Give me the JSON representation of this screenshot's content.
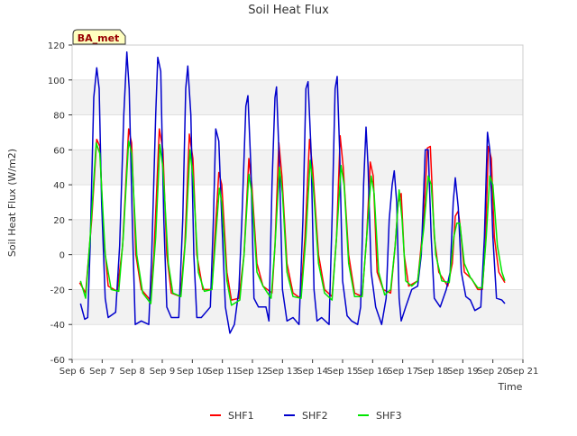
{
  "chart_data": {
    "type": "line",
    "title": "Soil Heat Flux",
    "xlabel": "Time",
    "ylabel": "Soil Heat Flux (W/m2)",
    "ylim": [
      -60,
      120
    ],
    "xlim": [
      0,
      15
    ],
    "x_ticks": [
      0,
      1,
      2,
      3,
      4,
      5,
      6,
      7,
      8,
      9,
      10,
      11,
      12,
      13,
      14,
      15
    ],
    "x_tick_labels": [
      "Sep 6",
      "Sep 7",
      "Sep 8",
      "Sep 9",
      "Sep 10",
      "Sep 11",
      "Sep 12",
      "Sep 13",
      "Sep 14",
      "Sep 15",
      "Sep 16",
      "Sep 17",
      "Sep 18",
      "Sep 19",
      "Sep 20",
      "Sep 21"
    ],
    "y_ticks": [
      -60,
      -40,
      -20,
      0,
      20,
      40,
      60,
      80,
      100,
      120
    ],
    "grid": "horizontal alternating bands",
    "legend_position": "bottom-center",
    "annotation": "BA_met",
    "series": [
      {
        "name": "SHF1",
        "color": "#ff0000",
        "points": [
          [
            0.25,
            -16
          ],
          [
            0.45,
            -22
          ],
          [
            0.65,
            20
          ],
          [
            0.82,
            66
          ],
          [
            0.92,
            62
          ],
          [
            1.05,
            10
          ],
          [
            1.2,
            -18
          ],
          [
            1.5,
            -21
          ],
          [
            1.68,
            5
          ],
          [
            1.88,
            72
          ],
          [
            1.98,
            64
          ],
          [
            2.12,
            0
          ],
          [
            2.3,
            -20
          ],
          [
            2.6,
            -26
          ],
          [
            2.72,
            0
          ],
          [
            2.9,
            72
          ],
          [
            3.02,
            60
          ],
          [
            3.15,
            0
          ],
          [
            3.3,
            -22
          ],
          [
            3.6,
            -24
          ],
          [
            3.75,
            5
          ],
          [
            3.9,
            69
          ],
          [
            4.02,
            55
          ],
          [
            4.15,
            0
          ],
          [
            4.35,
            -20
          ],
          [
            4.65,
            -20
          ],
          [
            4.75,
            10
          ],
          [
            4.88,
            47
          ],
          [
            4.98,
            40
          ],
          [
            5.15,
            -10
          ],
          [
            5.3,
            -26
          ],
          [
            5.55,
            -25
          ],
          [
            5.72,
            0
          ],
          [
            5.88,
            55
          ],
          [
            5.98,
            40
          ],
          [
            6.15,
            -5
          ],
          [
            6.35,
            -18
          ],
          [
            6.65,
            -22
          ],
          [
            6.75,
            5
          ],
          [
            6.88,
            64
          ],
          [
            6.98,
            45
          ],
          [
            7.15,
            -5
          ],
          [
            7.35,
            -22
          ],
          [
            7.6,
            -25
          ],
          [
            7.75,
            10
          ],
          [
            7.9,
            66
          ],
          [
            8.0,
            50
          ],
          [
            8.2,
            0
          ],
          [
            8.4,
            -20
          ],
          [
            8.65,
            -24
          ],
          [
            8.8,
            10
          ],
          [
            8.92,
            68
          ],
          [
            9.02,
            50
          ],
          [
            9.2,
            0
          ],
          [
            9.4,
            -22
          ],
          [
            9.65,
            -24
          ],
          [
            9.8,
            10
          ],
          [
            9.92,
            53
          ],
          [
            10.02,
            45
          ],
          [
            10.15,
            -10
          ],
          [
            10.35,
            -20
          ],
          [
            10.6,
            -22
          ],
          [
            10.75,
            5
          ],
          [
            10.85,
            30
          ],
          [
            10.95,
            35
          ],
          [
            11.05,
            0
          ],
          [
            11.2,
            -18
          ],
          [
            11.5,
            -15
          ],
          [
            11.7,
            20
          ],
          [
            11.82,
            61
          ],
          [
            11.92,
            62
          ],
          [
            12.05,
            10
          ],
          [
            12.2,
            -10
          ],
          [
            12.5,
            -18
          ],
          [
            12.65,
            -5
          ],
          [
            12.75,
            22
          ],
          [
            12.85,
            25
          ],
          [
            12.92,
            15
          ],
          [
            13.05,
            -10
          ],
          [
            13.3,
            -14
          ],
          [
            13.5,
            -20
          ],
          [
            13.65,
            -20
          ],
          [
            13.75,
            5
          ],
          [
            13.85,
            62
          ],
          [
            13.95,
            55
          ],
          [
            14.05,
            10
          ],
          [
            14.2,
            -10
          ],
          [
            14.4,
            -16
          ]
        ]
      },
      {
        "name": "SHF2",
        "color": "#0000cc",
        "points": [
          [
            0.28,
            -28
          ],
          [
            0.42,
            -37
          ],
          [
            0.52,
            -36
          ],
          [
            0.6,
            5
          ],
          [
            0.72,
            90
          ],
          [
            0.82,
            107
          ],
          [
            0.9,
            95
          ],
          [
            0.98,
            30
          ],
          [
            1.1,
            -25
          ],
          [
            1.2,
            -36
          ],
          [
            1.45,
            -33
          ],
          [
            1.58,
            5
          ],
          [
            1.72,
            80
          ],
          [
            1.82,
            116
          ],
          [
            1.9,
            95
          ],
          [
            2.0,
            20
          ],
          [
            2.1,
            -40
          ],
          [
            2.3,
            -38
          ],
          [
            2.55,
            -40
          ],
          [
            2.65,
            0
          ],
          [
            2.78,
            80
          ],
          [
            2.85,
            113
          ],
          [
            2.95,
            105
          ],
          [
            3.05,
            20
          ],
          [
            3.15,
            -30
          ],
          [
            3.3,
            -36
          ],
          [
            3.55,
            -36
          ],
          [
            3.68,
            20
          ],
          [
            3.78,
            95
          ],
          [
            3.85,
            108
          ],
          [
            3.95,
            80
          ],
          [
            4.05,
            0
          ],
          [
            4.15,
            -36
          ],
          [
            4.3,
            -36
          ],
          [
            4.6,
            -30
          ],
          [
            4.7,
            20
          ],
          [
            4.78,
            72
          ],
          [
            4.88,
            65
          ],
          [
            4.98,
            20
          ],
          [
            5.1,
            -30
          ],
          [
            5.25,
            -45
          ],
          [
            5.4,
            -40
          ],
          [
            5.55,
            -20
          ],
          [
            5.65,
            20
          ],
          [
            5.78,
            85
          ],
          [
            5.85,
            91
          ],
          [
            5.95,
            50
          ],
          [
            6.05,
            -25
          ],
          [
            6.2,
            -30
          ],
          [
            6.45,
            -30
          ],
          [
            6.55,
            -38
          ],
          [
            6.65,
            40
          ],
          [
            6.75,
            90
          ],
          [
            6.8,
            96
          ],
          [
            6.9,
            50
          ],
          [
            7.0,
            -20
          ],
          [
            7.15,
            -38
          ],
          [
            7.35,
            -36
          ],
          [
            7.55,
            -40
          ],
          [
            7.68,
            20
          ],
          [
            7.78,
            95
          ],
          [
            7.85,
            99
          ],
          [
            7.95,
            60
          ],
          [
            8.05,
            -20
          ],
          [
            8.15,
            -38
          ],
          [
            8.3,
            -36
          ],
          [
            8.55,
            -40
          ],
          [
            8.65,
            20
          ],
          [
            8.75,
            95
          ],
          [
            8.82,
            102
          ],
          [
            8.9,
            60
          ],
          [
            9.0,
            -15
          ],
          [
            9.15,
            -35
          ],
          [
            9.3,
            -38
          ],
          [
            9.5,
            -40
          ],
          [
            9.6,
            -30
          ],
          [
            9.7,
            40
          ],
          [
            9.78,
            73
          ],
          [
            9.85,
            50
          ],
          [
            9.95,
            -10
          ],
          [
            10.1,
            -30
          ],
          [
            10.3,
            -40
          ],
          [
            10.45,
            -25
          ],
          [
            10.55,
            20
          ],
          [
            10.65,
            40
          ],
          [
            10.72,
            48
          ],
          [
            10.8,
            30
          ],
          [
            10.88,
            -25
          ],
          [
            10.95,
            -38
          ],
          [
            11.1,
            -30
          ],
          [
            11.3,
            -20
          ],
          [
            11.5,
            -18
          ],
          [
            11.62,
            0
          ],
          [
            11.75,
            60
          ],
          [
            11.85,
            60
          ],
          [
            11.95,
            10
          ],
          [
            12.05,
            -25
          ],
          [
            12.25,
            -30
          ],
          [
            12.45,
            -20
          ],
          [
            12.58,
            -10
          ],
          [
            12.68,
            30
          ],
          [
            12.75,
            44
          ],
          [
            12.85,
            27
          ],
          [
            12.95,
            -10
          ],
          [
            13.1,
            -24
          ],
          [
            13.25,
            -26
          ],
          [
            13.4,
            -32
          ],
          [
            13.6,
            -30
          ],
          [
            13.72,
            10
          ],
          [
            13.82,
            70
          ],
          [
            13.9,
            60
          ],
          [
            14.0,
            10
          ],
          [
            14.12,
            -25
          ],
          [
            14.3,
            -26
          ],
          [
            14.4,
            -28
          ]
        ]
      },
      {
        "name": "SHF3",
        "color": "#00e600",
        "points": [
          [
            0.28,
            -15
          ],
          [
            0.45,
            -25
          ],
          [
            0.6,
            10
          ],
          [
            0.8,
            64
          ],
          [
            0.92,
            58
          ],
          [
            1.1,
            0
          ],
          [
            1.3,
            -20
          ],
          [
            1.55,
            -21
          ],
          [
            1.7,
            10
          ],
          [
            1.88,
            65
          ],
          [
            1.98,
            58
          ],
          [
            2.15,
            0
          ],
          [
            2.35,
            -22
          ],
          [
            2.62,
            -28
          ],
          [
            2.78,
            10
          ],
          [
            2.92,
            63
          ],
          [
            3.02,
            50
          ],
          [
            3.2,
            -5
          ],
          [
            3.35,
            -22
          ],
          [
            3.62,
            -24
          ],
          [
            3.78,
            10
          ],
          [
            3.92,
            60
          ],
          [
            4.02,
            45
          ],
          [
            4.2,
            -10
          ],
          [
            4.4,
            -21
          ],
          [
            4.65,
            -20
          ],
          [
            4.78,
            10
          ],
          [
            4.9,
            38
          ],
          [
            4.98,
            30
          ],
          [
            5.15,
            -15
          ],
          [
            5.3,
            -29
          ],
          [
            5.58,
            -26
          ],
          [
            5.72,
            0
          ],
          [
            5.88,
            46
          ],
          [
            5.98,
            35
          ],
          [
            6.15,
            -10
          ],
          [
            6.35,
            -18
          ],
          [
            6.62,
            -25
          ],
          [
            6.75,
            5
          ],
          [
            6.9,
            50
          ],
          [
            7.0,
            35
          ],
          [
            7.15,
            -10
          ],
          [
            7.35,
            -24
          ],
          [
            7.62,
            -25
          ],
          [
            7.78,
            10
          ],
          [
            7.92,
            54
          ],
          [
            8.02,
            40
          ],
          [
            8.2,
            -5
          ],
          [
            8.4,
            -22
          ],
          [
            8.65,
            -26
          ],
          [
            8.8,
            10
          ],
          [
            8.95,
            51
          ],
          [
            9.05,
            40
          ],
          [
            9.2,
            -5
          ],
          [
            9.4,
            -24
          ],
          [
            9.65,
            -24
          ],
          [
            9.8,
            10
          ],
          [
            9.95,
            45
          ],
          [
            10.05,
            35
          ],
          [
            10.2,
            -10
          ],
          [
            10.4,
            -23
          ],
          [
            10.6,
            -20
          ],
          [
            10.75,
            5
          ],
          [
            10.88,
            37
          ],
          [
            10.98,
            20
          ],
          [
            11.1,
            -15
          ],
          [
            11.3,
            -18
          ],
          [
            11.5,
            -15
          ],
          [
            11.7,
            15
          ],
          [
            11.85,
            45
          ],
          [
            11.95,
            40
          ],
          [
            12.1,
            0
          ],
          [
            12.3,
            -15
          ],
          [
            12.55,
            -16
          ],
          [
            12.7,
            10
          ],
          [
            12.8,
            18
          ],
          [
            12.9,
            18
          ],
          [
            13.05,
            -5
          ],
          [
            13.25,
            -13
          ],
          [
            13.5,
            -19
          ],
          [
            13.65,
            -19
          ],
          [
            13.78,
            10
          ],
          [
            13.9,
            45
          ],
          [
            14.0,
            40
          ],
          [
            14.15,
            5
          ],
          [
            14.3,
            -10
          ],
          [
            14.4,
            -15
          ]
        ]
      }
    ]
  }
}
